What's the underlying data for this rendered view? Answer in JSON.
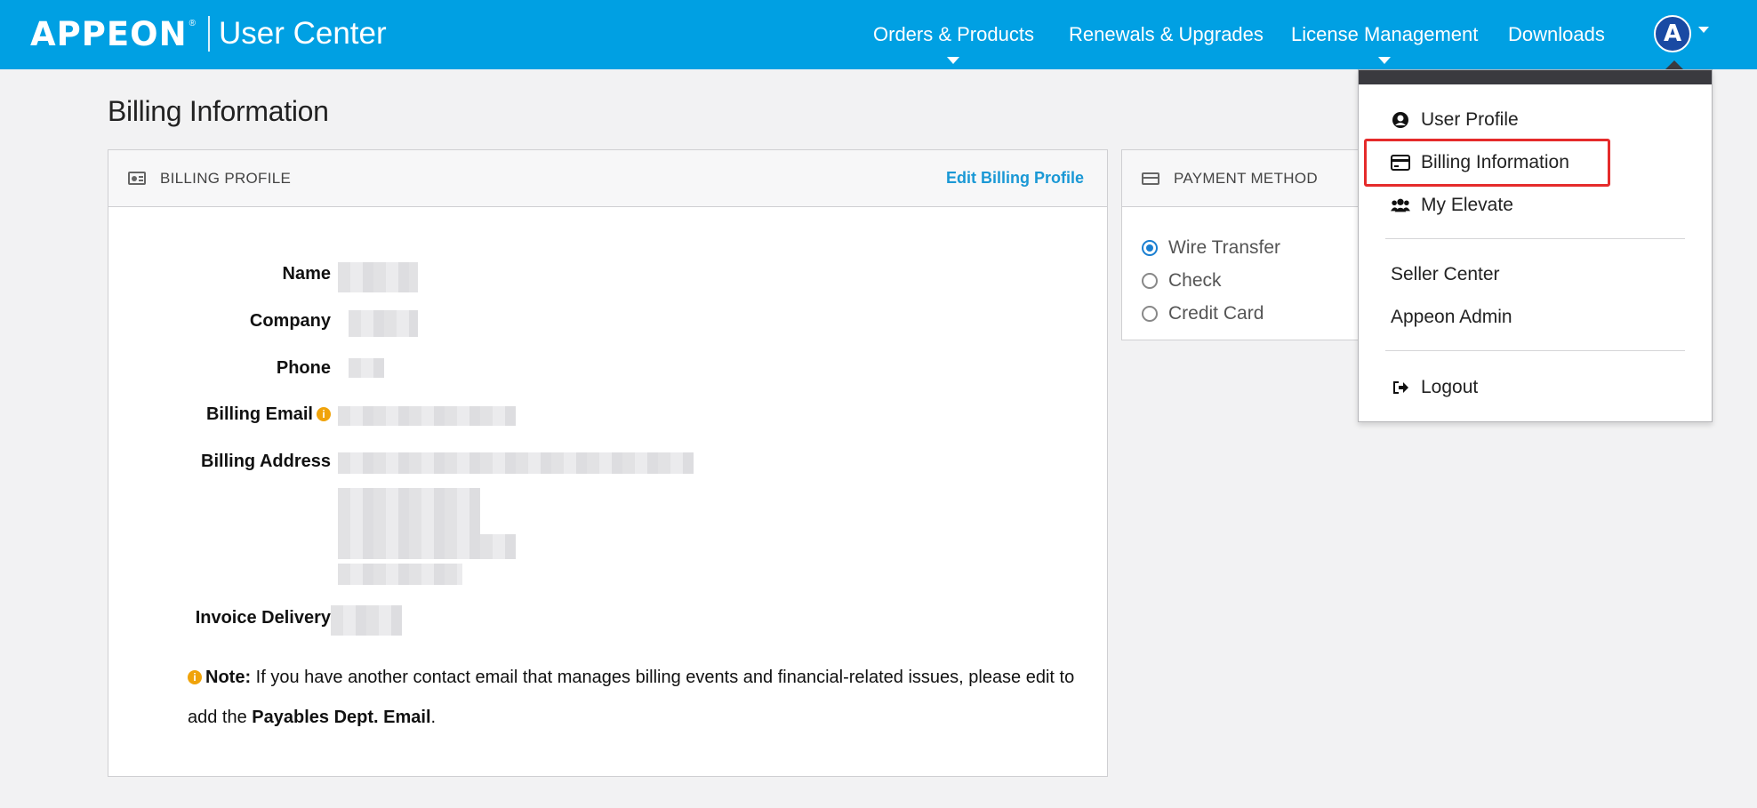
{
  "header": {
    "brand": "APPEON",
    "title": "User Center",
    "nav": [
      {
        "label": "Orders & Products",
        "has_caret": true
      },
      {
        "label": "Renewals & Upgrades",
        "has_caret": false
      },
      {
        "label": "License Management",
        "has_caret": true
      },
      {
        "label": "Downloads",
        "has_caret": false
      }
    ],
    "avatar_letter": "A"
  },
  "page": {
    "title": "Billing Information"
  },
  "billing_profile": {
    "heading": "BILLING PROFILE",
    "edit_link": "Edit Billing Profile",
    "fields": {
      "name": "Name",
      "company": "Company",
      "phone": "Phone",
      "billing_email": "Billing Email",
      "billing_address": "Billing Address",
      "invoice_delivery": "Invoice Delivery"
    },
    "note": {
      "icon": "info-icon",
      "prefix": "Note:",
      "text": " If you have another contact email that manages billing events and financial-related issues, please edit to add the ",
      "emphasis": "Payables Dept. Email",
      "suffix": "."
    }
  },
  "payment_method": {
    "heading": "PAYMENT METHOD",
    "options": [
      {
        "label": "Wire Transfer",
        "selected": true
      },
      {
        "label": "Check",
        "selected": false
      },
      {
        "label": "Credit Card",
        "selected": false
      }
    ]
  },
  "user_menu": {
    "items": [
      {
        "label": "User Profile",
        "icon": "user-circle-icon"
      },
      {
        "label": "Billing Information",
        "icon": "credit-card-icon"
      },
      {
        "label": "My Elevate",
        "icon": "users-icon"
      },
      {
        "label": "Seller Center"
      },
      {
        "label": "Appeon Admin"
      },
      {
        "label": "Logout",
        "icon": "sign-out-icon"
      }
    ]
  },
  "colors": {
    "topbar": "#00a0e3",
    "link": "#1a98d5",
    "highlight": "#e52b2b",
    "info": "#f0a30a"
  }
}
